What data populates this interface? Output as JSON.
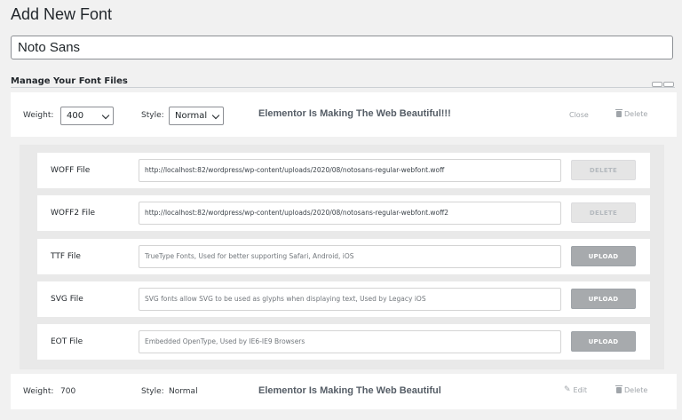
{
  "header": {
    "title": "Add New Font",
    "font_name_value": "Noto Sans"
  },
  "section": {
    "heading": "Manage Your Font Files"
  },
  "variation_open": {
    "weight_label": "Weight:",
    "weight_value": "400",
    "style_label": "Style:",
    "style_value": "Normal",
    "preview_text": "Elementor Is Making The Web Beautiful!!!",
    "close_label": "Close",
    "delete_label": "Delete"
  },
  "files": [
    {
      "label": "WOFF File",
      "value": "http://localhost:82/wordpress/wp-content/uploads/2020/08/notosans-regular-webfont.woff",
      "placeholder": "",
      "button": "DELETE"
    },
    {
      "label": "WOFF2 File",
      "value": "http://localhost:82/wordpress/wp-content/uploads/2020/08/notosans-regular-webfont.woff2",
      "placeholder": "",
      "button": "DELETE"
    },
    {
      "label": "TTF File",
      "value": "",
      "placeholder": "TrueType Fonts, Used for better supporting Safari, Android, iOS",
      "button": "UPLOAD"
    },
    {
      "label": "SVG File",
      "value": "",
      "placeholder": "SVG fonts allow SVG to be used as glyphs when displaying text, Used by Legacy iOS",
      "button": "UPLOAD"
    },
    {
      "label": "EOT File",
      "value": "",
      "placeholder": "Embedded OpenType, Used by IE6-IE9 Browsers",
      "button": "UPLOAD"
    }
  ],
  "variation_collapsed": {
    "weight_label": "Weight:",
    "weight_value": "700",
    "style_label": "Style:",
    "style_value": "Normal",
    "preview_text": "Elementor Is Making The Web Beautiful",
    "edit_label": "Edit",
    "delete_label": "Delete"
  },
  "colors": {
    "background": "#f1f1f1",
    "panel": "#e9e9e9",
    "upload_button": "#a7aaad",
    "delete_button_disabled": "#e5e5e5"
  },
  "icons": {
    "delete": "trash-icon",
    "edit": "pencil-icon"
  }
}
